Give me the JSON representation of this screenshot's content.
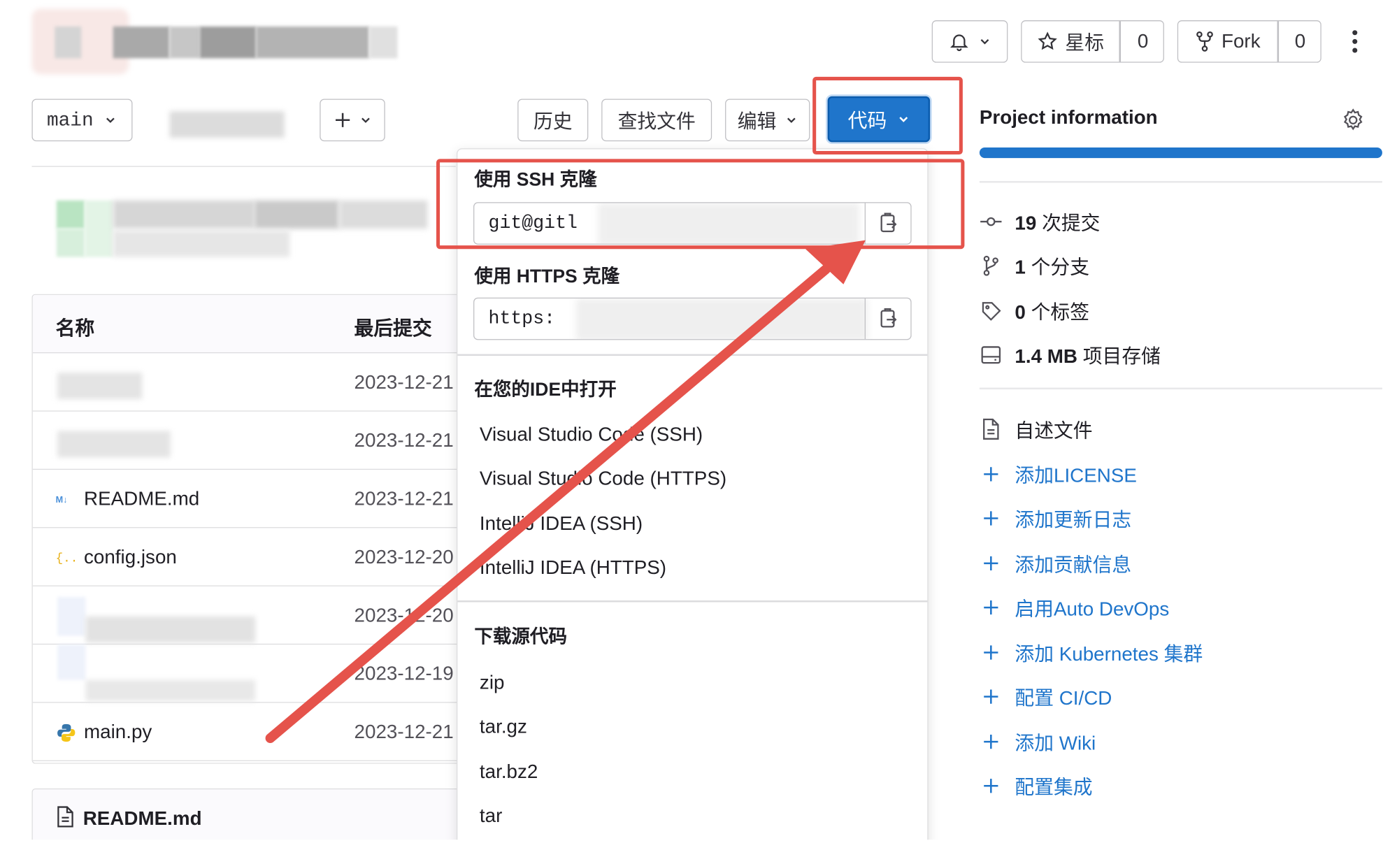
{
  "header": {
    "notify_label": "",
    "star_label": "星标",
    "star_count": "0",
    "fork_label": "Fork",
    "fork_count": "0"
  },
  "toolbar": {
    "branch": "main",
    "history": "历史",
    "find_file": "查找文件",
    "edit": "编辑",
    "code": "代码"
  },
  "table": {
    "col_name": "名称",
    "col_last_commit": "最后提交",
    "rows": [
      {
        "name": "",
        "date": "2023-12-21"
      },
      {
        "name": "",
        "date": "2023-12-21"
      },
      {
        "name": "README.md",
        "date": "2023-12-21"
      },
      {
        "name": "config.json",
        "date": "2023-12-20"
      },
      {
        "name": "",
        "date": "2023-12-20"
      },
      {
        "name": "",
        "date": "2023-12-19"
      },
      {
        "name": "main.py",
        "date": "2023-12-21"
      }
    ],
    "readme_title": "README.md"
  },
  "dropdown": {
    "ssh_heading": "使用 SSH 克隆",
    "ssh_value": "git@gitl",
    "https_heading": "使用 HTTPS 克隆",
    "https_value": "https:",
    "ide_heading": "在您的IDE中打开",
    "ide_items": [
      "Visual Studio Code (SSH)",
      "Visual Studio Code (HTTPS)",
      "IntelliJ IDEA (SSH)",
      "IntelliJ IDEA (HTTPS)"
    ],
    "download_heading": "下载源代码",
    "download_items": [
      "zip",
      "tar.gz",
      "tar.bz2",
      "tar"
    ]
  },
  "sidebar": {
    "title": "Project information",
    "stats": [
      {
        "bold": "19",
        "text": "次提交",
        "icon": "commit-icon"
      },
      {
        "bold": "1",
        "text": "个分支",
        "icon": "branch-icon"
      },
      {
        "bold": "0",
        "text": "个标签",
        "icon": "tag-icon"
      },
      {
        "bold": "1.4 MB",
        "text": "项目存储",
        "icon": "storage-icon"
      }
    ],
    "readme": "自述文件",
    "links": [
      "添加LICENSE",
      "添加更新日志",
      "添加贡献信息",
      "启用Auto DevOps",
      "添加 Kubernetes 集群",
      "配置 CI/CD",
      "添加 Wiki",
      "配置集成"
    ]
  },
  "colors": {
    "primary": "#1f75cb",
    "annotation": "#e5534b"
  }
}
